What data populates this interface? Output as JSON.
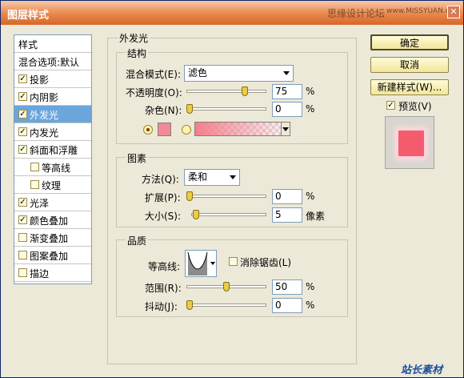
{
  "window": {
    "title": "图层样式",
    "watermark": "思缘设计论坛",
    "watermark_url": "www.MISSYUAN.com"
  },
  "sidebar": {
    "items": [
      {
        "label": "样式",
        "checkbox": false,
        "checked": false
      },
      {
        "label": "混合选项:默认",
        "checkbox": false,
        "checked": false
      },
      {
        "label": "投影",
        "checkbox": true,
        "checked": true
      },
      {
        "label": "内阴影",
        "checkbox": true,
        "checked": true
      },
      {
        "label": "外发光",
        "checkbox": true,
        "checked": true,
        "selected": true
      },
      {
        "label": "内发光",
        "checkbox": true,
        "checked": true
      },
      {
        "label": "斜面和浮雕",
        "checkbox": true,
        "checked": true
      },
      {
        "label": "等高线",
        "checkbox": true,
        "checked": false,
        "indent": true
      },
      {
        "label": "纹理",
        "checkbox": true,
        "checked": false,
        "indent": true
      },
      {
        "label": "光泽",
        "checkbox": true,
        "checked": true
      },
      {
        "label": "颜色叠加",
        "checkbox": true,
        "checked": true
      },
      {
        "label": "渐变叠加",
        "checkbox": true,
        "checked": false
      },
      {
        "label": "图案叠加",
        "checkbox": true,
        "checked": false
      },
      {
        "label": "描边",
        "checkbox": true,
        "checked": false
      }
    ]
  },
  "panel": {
    "title": "外发光",
    "structure": {
      "title": "结构",
      "blend_mode_label": "混合模式(E):",
      "blend_mode_value": "滤色",
      "opacity_label": "不透明度(O):",
      "opacity_value": "75",
      "opacity_level": 0.75,
      "noise_label": "杂色(N):",
      "noise_value": "0",
      "noise_level": 0.0,
      "percent": "%",
      "glow_color": "#f28a96"
    },
    "elements": {
      "title": "图素",
      "method_label": "方法(Q):",
      "method_value": "柔和",
      "spread_label": "扩展(P):",
      "spread_value": "0",
      "spread_level": 0.0,
      "size_label": "大小(S):",
      "size_value": "5",
      "size_level": 0.02,
      "percent": "%",
      "px": "像素"
    },
    "quality": {
      "title": "品质",
      "contour_label": "等高线:",
      "antialias_label": "消除锯齿(L)",
      "antialias_checked": false,
      "range_label": "范围(R):",
      "range_value": "50",
      "range_level": 0.5,
      "jitter_label": "抖动(J):",
      "jitter_value": "0",
      "jitter_level": 0.0,
      "percent": "%"
    }
  },
  "buttons": {
    "ok": "确定",
    "cancel": "取消",
    "new_style": "新建样式(W)...",
    "preview_label": "预览(V)",
    "preview_checked": true
  },
  "footer_watermark": "站长素材"
}
